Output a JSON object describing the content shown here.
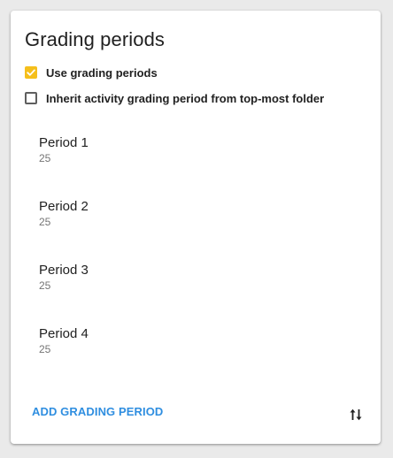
{
  "panel": {
    "title": "Grading periods"
  },
  "options": {
    "use_grading_periods": {
      "label": "Use grading periods",
      "checked": true
    },
    "inherit_period": {
      "label": "Inherit activity grading period from top-most folder",
      "checked": false
    }
  },
  "periods": [
    {
      "name": "Period 1",
      "weight": "25"
    },
    {
      "name": "Period 2",
      "weight": "25"
    },
    {
      "name": "Period 3",
      "weight": "25"
    },
    {
      "name": "Period 4",
      "weight": "25"
    }
  ],
  "footer": {
    "add_label": "ADD GRADING PERIOD",
    "sort_icon": "swap-vert-icon"
  },
  "colors": {
    "checkbox_accent": "#f5bf1b",
    "link_accent": "#2f8ee0"
  }
}
